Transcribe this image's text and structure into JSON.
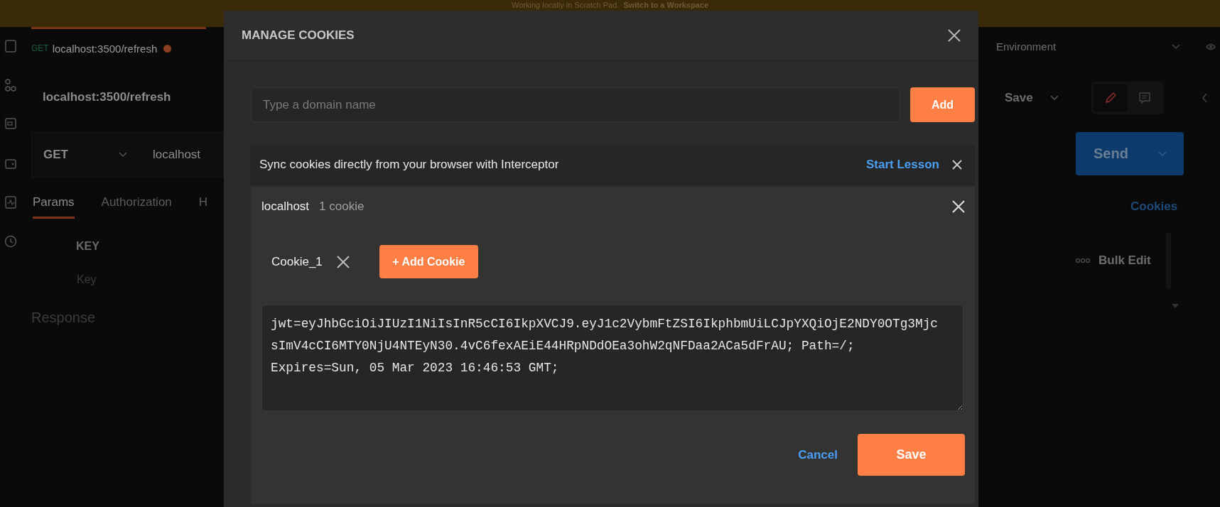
{
  "banner": {
    "text": "Working locally in Scratch Pad.",
    "link": "Switch to a Workspace"
  },
  "request_tab": {
    "method": "GET",
    "url": "localhost:3500/refresh",
    "unsaved": true
  },
  "request": {
    "title": "localhost:3500/refresh",
    "method": "GET",
    "url": "localhost"
  },
  "request_tabs": [
    {
      "label": "Params",
      "selected": true
    },
    {
      "label": "Authorization",
      "selected": false
    },
    {
      "label": "H",
      "selected": false
    }
  ],
  "params": {
    "column": "KEY",
    "placeholder": "Key"
  },
  "response": {
    "label": "Response"
  },
  "environment": {
    "label": "Environment"
  },
  "save": {
    "label": "Save"
  },
  "view_modes": [
    {
      "kind": "edit",
      "selected": true
    },
    {
      "kind": "comments",
      "selected": false
    }
  ],
  "send": {
    "label": "Send"
  },
  "cookies_link": "Cookies",
  "bulk_edit": "Bulk Edit",
  "modal": {
    "title": "MANAGE COOKIES",
    "domain_field": {
      "placeholder": "Type a domain name"
    },
    "add_button": "Add",
    "interceptor": {
      "text": "Sync cookies directly from your browser with Interceptor",
      "link": "Start Lesson"
    },
    "domains": [
      {
        "name": "localhost",
        "count": "1 cookie",
        "cookies": [
          {
            "name": "Cookie_1"
          }
        ],
        "add_cookie": "+ Add Cookie",
        "editor_value": "jwt=eyJhbGciOiJIUzI1NiIsInR5cCI6IkpXVCJ9.eyJ1c2VybmFtZSI6IkphbmUiLCJpYXQiOjE2NDY0OTg3MjcsImV4cCI6MTY0NjU4NTEyN30.4vC6fexAEiE44HRpNDdOEa3ohW2qNFDaa2ACa5dFrAU; Path=/; Expires=Sun, 05 Mar 2023 16:46:53 GMT;"
      }
    ],
    "cancel": "Cancel",
    "save": "Save"
  }
}
